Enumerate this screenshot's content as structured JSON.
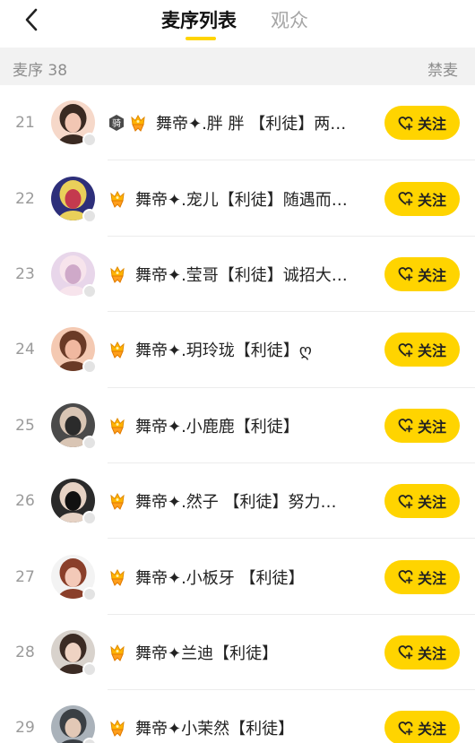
{
  "header": {
    "back_icon": "chevron-left-icon",
    "tabs": [
      {
        "label": "麦序列表",
        "active": true
      },
      {
        "label": "观众",
        "active": false
      }
    ],
    "accent_color": "#ffd400"
  },
  "subheader": {
    "count_label": "麦序 38",
    "mute_label": "禁麦"
  },
  "users": [
    {
      "index": "21",
      "name": "舞帝✦.胖 胖 【利徒】两…",
      "badges": [
        "ride-badge",
        "crown-badge"
      ],
      "follow_label": "关注"
    },
    {
      "index": "22",
      "name": "舞帝✦.宠儿【利徒】随遇而…",
      "badges": [
        "crown-badge"
      ],
      "follow_label": "关注"
    },
    {
      "index": "23",
      "name": "舞帝✦.莹哥【利徒】诚招大…",
      "badges": [
        "crown-badge"
      ],
      "follow_label": "关注"
    },
    {
      "index": "24",
      "name": "舞帝✦.玥玲珑【利徒】ღ",
      "badges": [
        "crown-badge"
      ],
      "follow_label": "关注"
    },
    {
      "index": "25",
      "name": "舞帝✦.小鹿鹿【利徒】",
      "badges": [
        "crown-badge"
      ],
      "follow_label": "关注"
    },
    {
      "index": "26",
      "name": "舞帝✦.然子 【利徒】努力…",
      "badges": [
        "crown-badge"
      ],
      "follow_label": "关注"
    },
    {
      "index": "27",
      "name": "舞帝✦.小板牙 【利徒】",
      "badges": [
        "crown-badge"
      ],
      "follow_label": "关注"
    },
    {
      "index": "28",
      "name": "舞帝✦兰迪【利徒】",
      "badges": [
        "crown-badge"
      ],
      "follow_label": "关注"
    },
    {
      "index": "29",
      "name": "舞帝✦小茉然【利徒】",
      "badges": [
        "crown-badge"
      ],
      "follow_label": "关注"
    }
  ],
  "ride_badge_text": "骑",
  "follow_icon": "heart-plus-icon"
}
